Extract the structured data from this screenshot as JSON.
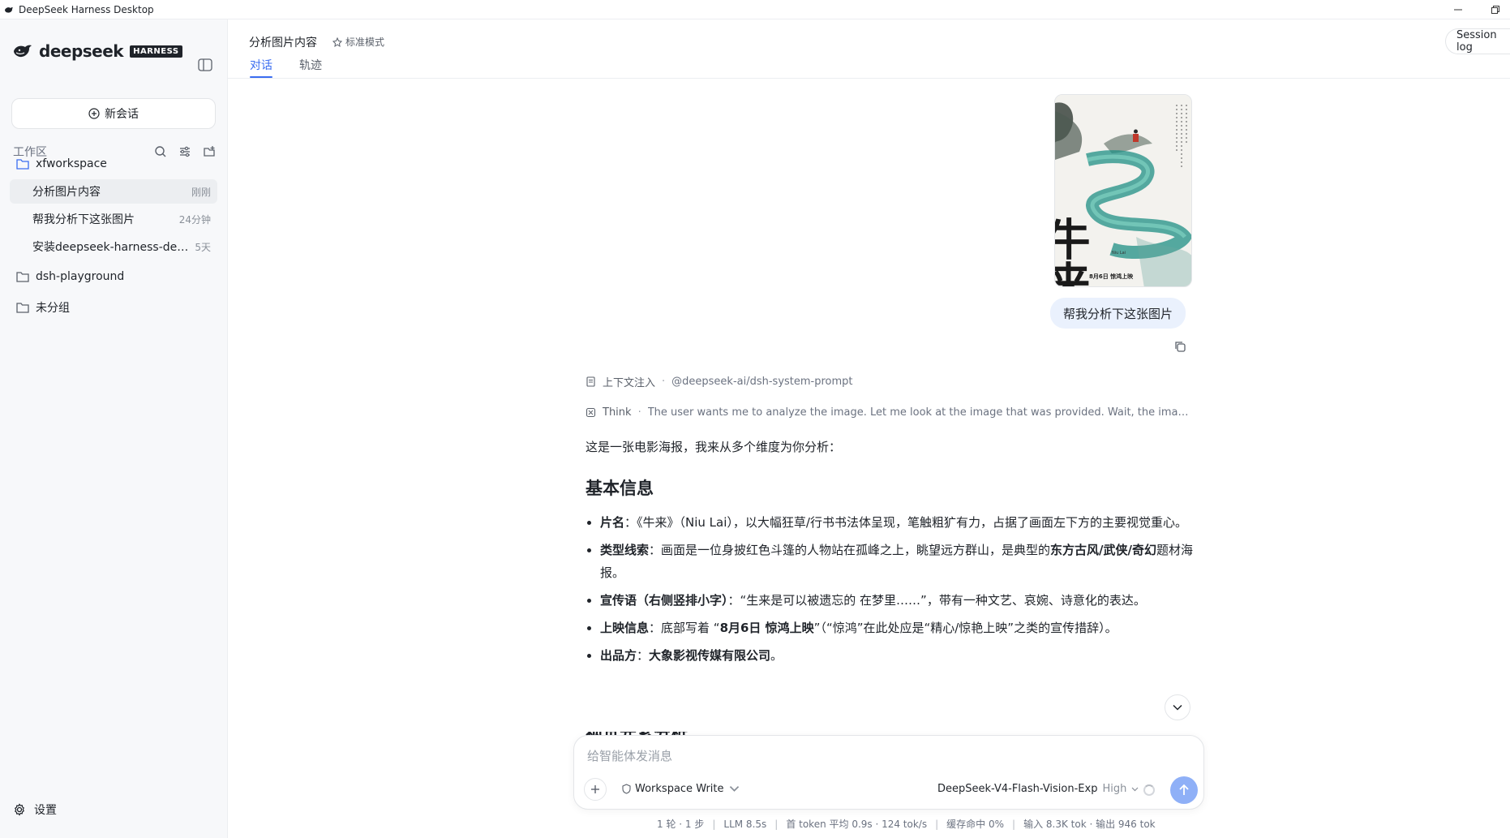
{
  "window": {
    "title": "DeepSeek Harness Desktop"
  },
  "sidebar": {
    "logo_text": "deepseek",
    "logo_badge": "HARNESS",
    "new_chat_label": "新会话",
    "workspace_label": "工作区",
    "tree": [
      {
        "name": "xfworkspace",
        "sessions": [
          {
            "label": "分析图片内容",
            "time": "刚刚",
            "active": true
          },
          {
            "label": "帮我分析下这张图片",
            "time": "24分钟"
          },
          {
            "label": "安装deepseek-harness-deskt...",
            "time": "5天"
          }
        ]
      },
      {
        "name": "dsh-playground"
      },
      {
        "name": "未分组"
      }
    ],
    "settings_label": "设置"
  },
  "header": {
    "title": "分析图片内容",
    "mode": "标准模式",
    "tabs": [
      {
        "label": "对话",
        "active": true
      },
      {
        "label": "轨迹"
      }
    ],
    "session_log_label": "Session log"
  },
  "chat": {
    "user_message": "帮我分析下这张图片",
    "poster": {
      "title_chars": "牛来",
      "small_title": "Niu Lai",
      "release_line": "8月6日 惊鸿上映"
    },
    "context_label": "上下文注入",
    "context_value": "@deepseek-ai/dsh-system-prompt",
    "think_label": "Think",
    "think_text": "The user wants me to analyze the image. Let me look at the image that was provided. Wait, the image was ...",
    "answer": {
      "intro": "这是一张电影海报，我来从多个维度为你分析：",
      "heading": "基本信息",
      "items": [
        {
          "key": "片名",
          "text": "：《牛来》（Niu Lai），以大幅狂草/行书书法体呈现，笔触粗犷有力，占据了画面左下方的主要视觉重心。"
        },
        {
          "key": "类型线索",
          "text": "：画面是一位身披红色斗篷的人物站在孤峰之上，眺望远方群山，是典型的",
          "bold_tail": "东方古风/武侠/奇幻",
          "tail": "题材海报。"
        },
        {
          "key": "宣传语（右侧竖排小字）",
          "text": "：“生来是可以被遗忘的 在梦里……”，带有一种文艺、哀婉、诗意化的表达。"
        },
        {
          "key": "上映信息",
          "text": "：底部写着 “",
          "bold_mid": "8月6日 惊鸿上映",
          "tail": "”（“惊鸿”在此处应是“精心/惊艳上映”之类的宣传措辞）。"
        },
        {
          "key": "出品方",
          "text": "：",
          "bold_mid": "大象影视传媒有限公司",
          "tail": "。"
        }
      ],
      "next_heading_partial": "视觉元素分析"
    }
  },
  "composer": {
    "placeholder": "给智能体发消息",
    "permission": "Workspace Write",
    "model": "DeepSeek-V4-Flash-Vision-Exp",
    "effort": "High"
  },
  "stats": {
    "turns": "1 轮 · 1 步",
    "llm": "LLM 8.5s",
    "token": "首 token 平均 0.9s · 124 tok/s",
    "cache": "缓存命中 0%",
    "io": "输入 8.3K tok · 输出 946 tok"
  },
  "colors": {
    "accent": "#3b6df0",
    "user_bubble": "#eaf1fd",
    "send_button": "#8fb0f7"
  }
}
